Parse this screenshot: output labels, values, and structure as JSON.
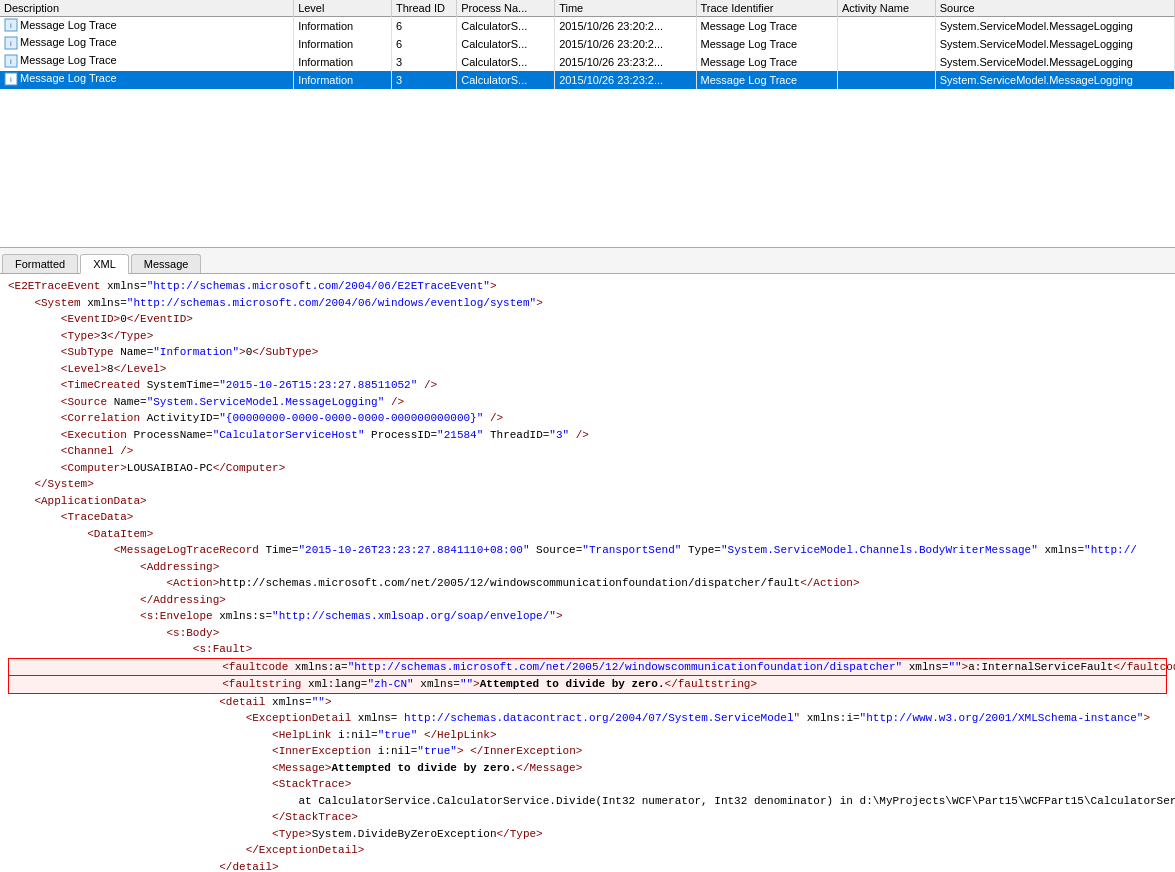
{
  "table": {
    "columns": [
      "Description",
      "Level",
      "Thread ID",
      "Process Na...",
      "Time",
      "Trace Identifier",
      "Activity Name",
      "Source"
    ],
    "rows": [
      {
        "description": "Message Log Trace",
        "level": "Information",
        "threadId": "6",
        "processName": "CalculatorS...",
        "time": "2015/10/26 23:20:2...",
        "traceId": "Message Log Trace",
        "activityName": "",
        "source": "System.ServiceModel.MessageLogging",
        "selected": false
      },
      {
        "description": "Message Log Trace",
        "level": "Information",
        "threadId": "6",
        "processName": "CalculatorS...",
        "time": "2015/10/26 23:20:2...",
        "traceId": "Message Log Trace",
        "activityName": "",
        "source": "System.ServiceModel.MessageLogging",
        "selected": false
      },
      {
        "description": "Message Log Trace",
        "level": "Information",
        "threadId": "3",
        "processName": "CalculatorS...",
        "time": "2015/10/26 23:23:2...",
        "traceId": "Message Log Trace",
        "activityName": "",
        "source": "System.ServiceModel.MessageLogging",
        "selected": false
      },
      {
        "description": "Message Log Trace",
        "level": "Information",
        "threadId": "3",
        "processName": "CalculatorS...",
        "time": "2015/10/26 23:23:2...",
        "traceId": "Message Log Trace",
        "activityName": "",
        "source": "System.ServiceModel.MessageLogging",
        "selected": true
      }
    ]
  },
  "tabs": [
    {
      "label": "Formatted",
      "active": false
    },
    {
      "label": "XML",
      "active": true
    },
    {
      "label": "Message",
      "active": false
    }
  ],
  "xml": {
    "content": "xml_content"
  }
}
